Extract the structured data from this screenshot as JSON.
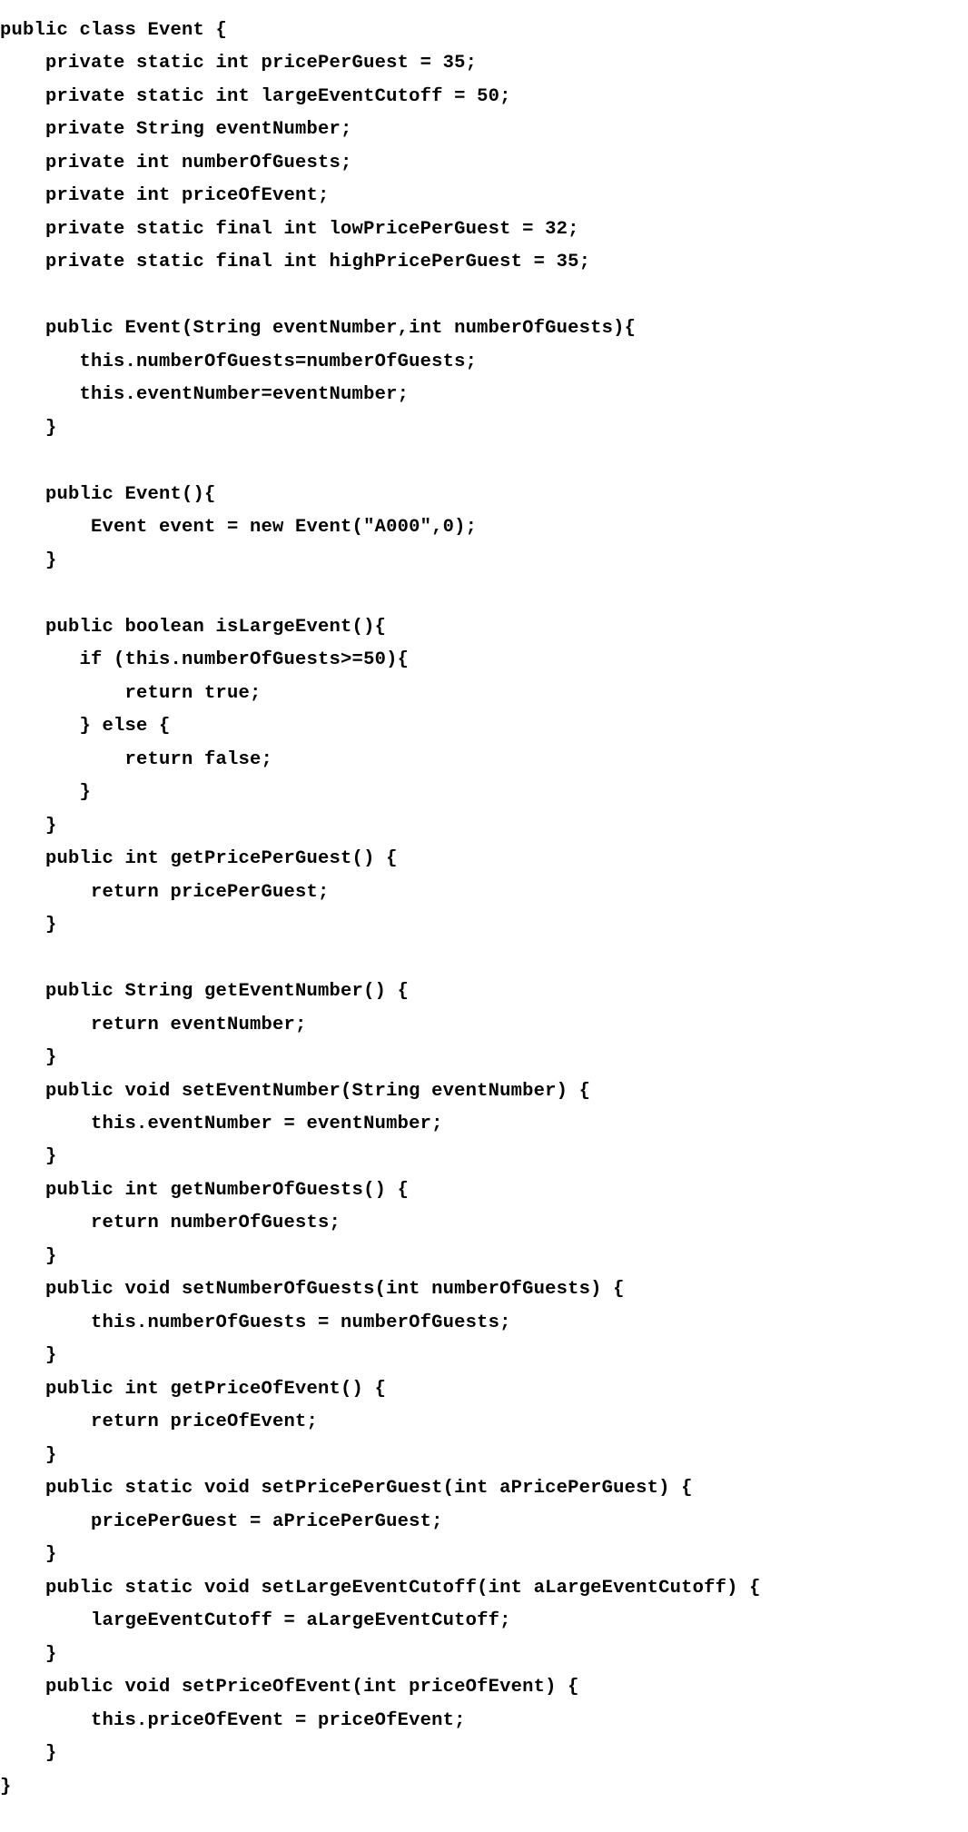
{
  "code_lines": [
    "public class Event {",
    "    private static int pricePerGuest = 35;",
    "    private static int largeEventCutoff = 50;",
    "    private String eventNumber;",
    "    private int numberOfGuests;",
    "    private int priceOfEvent;",
    "    private static final int lowPricePerGuest = 32;",
    "    private static final int highPricePerGuest = 35;",
    "",
    "    public Event(String eventNumber,int numberOfGuests){",
    "       this.numberOfGuests=numberOfGuests;",
    "       this.eventNumber=eventNumber;",
    "    }",
    "",
    "    public Event(){",
    "        Event event = new Event(\"A000\",0);",
    "    }",
    "",
    "    public boolean isLargeEvent(){",
    "       if (this.numberOfGuests>=50){",
    "           return true;",
    "       } else {",
    "           return false;",
    "       }",
    "    }",
    "    public int getPricePerGuest() {",
    "        return pricePerGuest;",
    "    }",
    "",
    "    public String getEventNumber() {",
    "        return eventNumber;",
    "    }",
    "    public void setEventNumber(String eventNumber) {",
    "        this.eventNumber = eventNumber;",
    "    }",
    "    public int getNumberOfGuests() {",
    "        return numberOfGuests;",
    "    }",
    "    public void setNumberOfGuests(int numberOfGuests) {",
    "        this.numberOfGuests = numberOfGuests;",
    "    }",
    "    public int getPriceOfEvent() {",
    "        return priceOfEvent;",
    "    }",
    "    public static void setPricePerGuest(int aPricePerGuest) {",
    "        pricePerGuest = aPricePerGuest;",
    "    }",
    "    public static void setLargeEventCutoff(int aLargeEventCutoff) {",
    "        largeEventCutoff = aLargeEventCutoff;",
    "    }",
    "    public void setPriceOfEvent(int priceOfEvent) {",
    "        this.priceOfEvent = priceOfEvent;",
    "    }",
    "}"
  ]
}
